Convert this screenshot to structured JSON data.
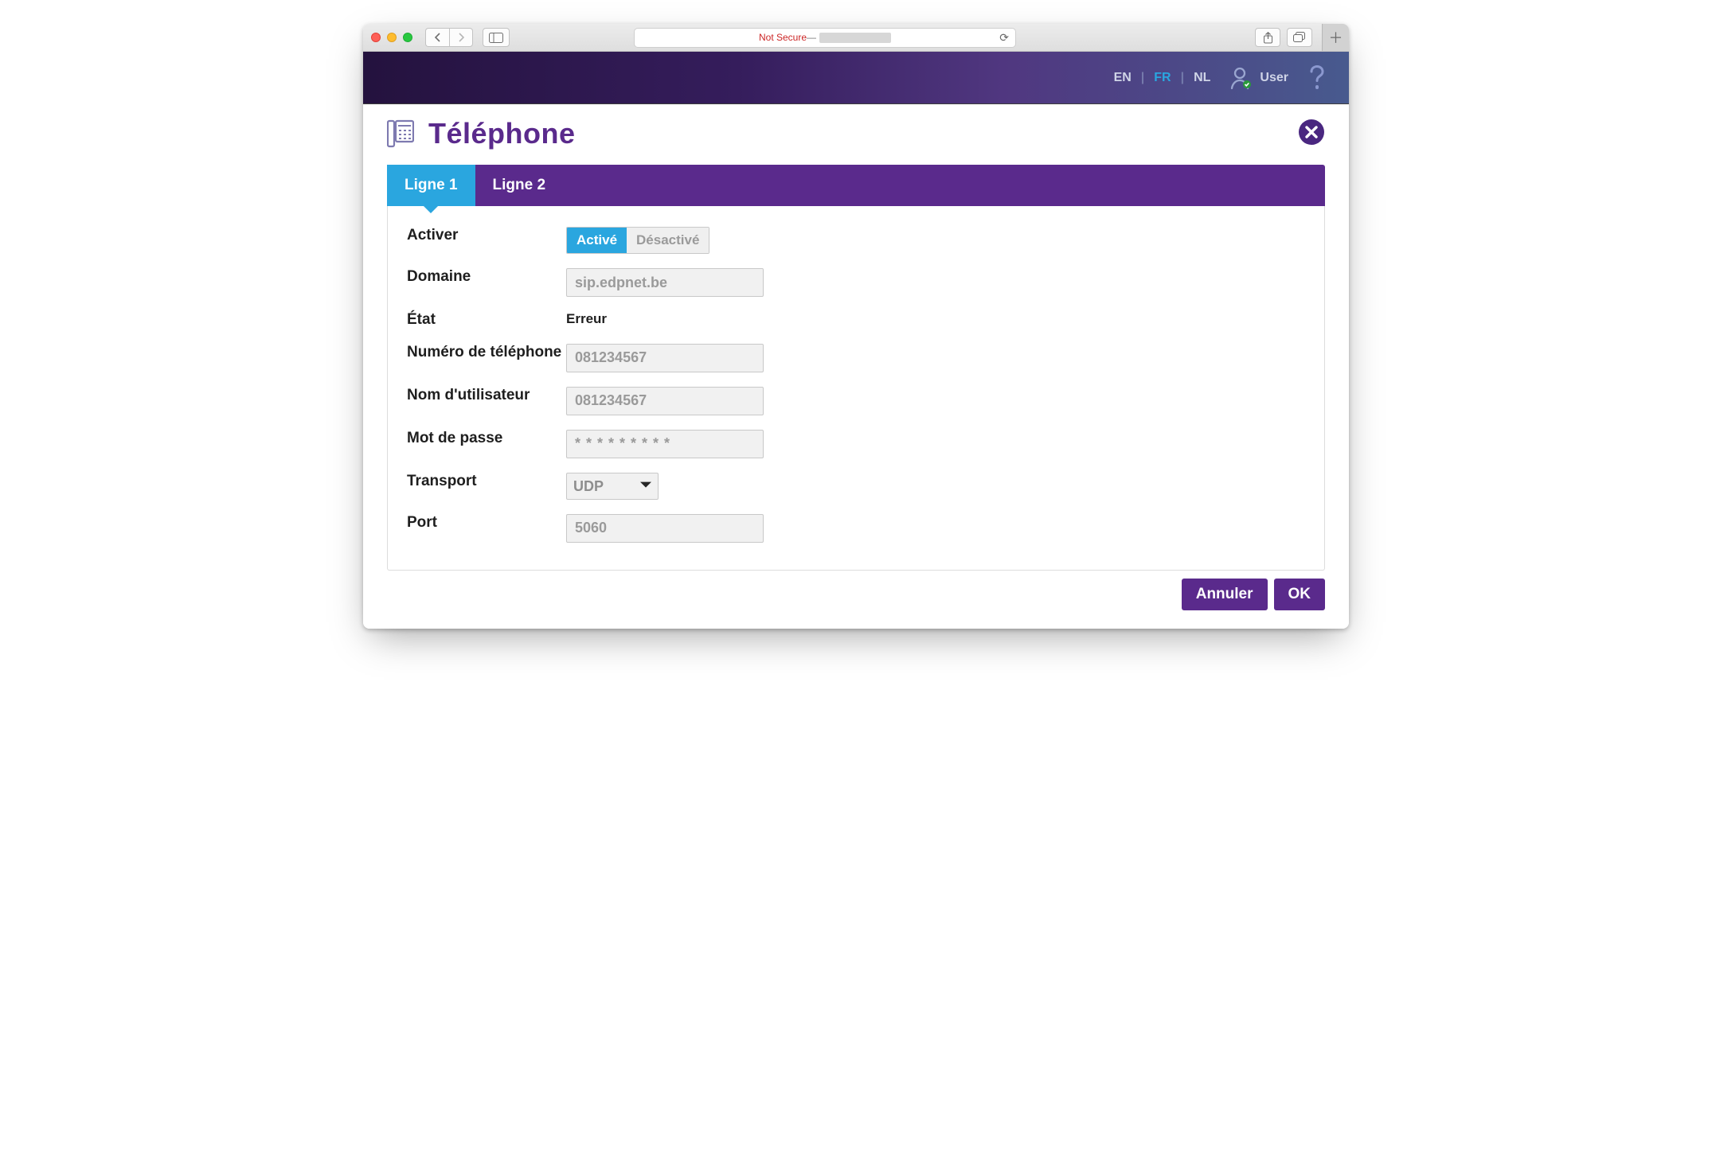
{
  "browser": {
    "security": "Not Secure",
    "sep": " — "
  },
  "header": {
    "langs": {
      "en": "EN",
      "fr": "FR",
      "nl": "NL",
      "active": "fr"
    },
    "user": "User"
  },
  "panel": {
    "title": "Téléphone",
    "tabs": {
      "line1": "Ligne 1",
      "line2": "Ligne 2"
    }
  },
  "form": {
    "activate": {
      "label": "Activer",
      "on": "Activé",
      "off": "Désactivé"
    },
    "domain": {
      "label": "Domaine",
      "value": "sip.edpnet.be"
    },
    "status": {
      "label": "État",
      "value": "Erreur"
    },
    "phone": {
      "label": "Numéro de téléphone",
      "value": "081234567"
    },
    "username": {
      "label": "Nom d'utilisateur",
      "value": "081234567"
    },
    "password": {
      "label": "Mot de passe",
      "masked": "* * * * * * * * *"
    },
    "transport": {
      "label": "Transport",
      "value": "UDP"
    },
    "port": {
      "label": "Port",
      "value": "5060"
    }
  },
  "actions": {
    "cancel": "Annuler",
    "ok": "OK"
  }
}
